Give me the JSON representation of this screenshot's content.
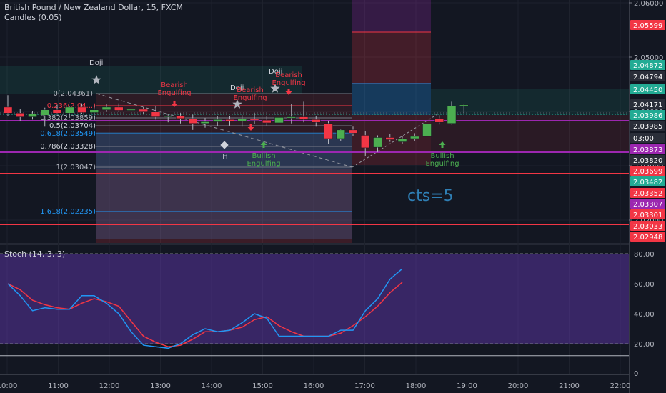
{
  "header": {
    "symbol": "British Pound / New Zealand Dollar, 15, FXCM",
    "indicator": "Candles (0.05)"
  },
  "stoch": {
    "label": "Stoch (14, 3, 3)",
    "k": [
      60,
      52,
      42,
      44,
      43,
      43,
      52,
      52,
      47,
      40,
      28,
      19,
      18,
      17,
      20,
      26,
      30,
      28,
      29,
      34,
      40,
      37,
      25,
      25,
      25,
      25,
      25,
      29,
      29,
      42,
      50,
      63,
      70
    ],
    "d": [
      60,
      56,
      49,
      46,
      44,
      43,
      47,
      50,
      48,
      45,
      35,
      25,
      21,
      18,
      19,
      23,
      28,
      28,
      29,
      31,
      36,
      38,
      32,
      28,
      25,
      25,
      25,
      27,
      32,
      38,
      45,
      54,
      61
    ],
    "k_color": "#2196f3",
    "d_color": "#f23645",
    "ticks": [
      "80.00",
      "60.00",
      "40.00",
      "20.00",
      "0"
    ]
  },
  "price_axis": {
    "ticks": [
      "2.06000",
      "2.05000",
      "2.04000",
      "2.03000",
      "2.02000"
    ],
    "badges": [
      {
        "text": "2.05599",
        "color": "#f23645"
      },
      {
        "text": "2.04872",
        "color": "#22ab94"
      },
      {
        "text": "2.04794",
        "color": "#2a2e39"
      },
      {
        "text": "2.04450",
        "color": "#22ab94"
      },
      {
        "text": "2.04171",
        "color": "#2a2e39"
      },
      {
        "text": "2.03986",
        "color": "#22ab94"
      },
      {
        "text": "2.03985",
        "color": "#2a2e39"
      },
      {
        "text": "03:00",
        "color": "#2a2e39"
      },
      {
        "text": "2.03873",
        "color": "#9c27b0"
      },
      {
        "text": "2.03820",
        "color": "#2a2e39"
      },
      {
        "text": "2.03699",
        "color": "#f23645"
      },
      {
        "text": "2.03482",
        "color": "#22ab94"
      },
      {
        "text": "2.03352",
        "color": "#f23645"
      },
      {
        "text": "2.03307",
        "color": "#9c27b0"
      },
      {
        "text": "2.03301",
        "color": "#f23645"
      },
      {
        "text": "2.03033",
        "color": "#f23645"
      },
      {
        "text": "2.02948",
        "color": "#f23645"
      }
    ]
  },
  "time_axis": {
    "ticks": [
      "10:00",
      "11:00",
      "12:00",
      "13:00",
      "14:00",
      "15:00",
      "16:00",
      "17:00",
      "18:00",
      "19:00",
      "20:00",
      "21:00",
      "22:00"
    ]
  },
  "fib": {
    "levels": [
      {
        "text": "0(2.04361)",
        "color": "#b2b5be"
      },
      {
        "text": "0.236(2.04...)",
        "color": "#f23645"
      },
      {
        "text": "0.382(2.03859)",
        "color": "#b2b5be"
      },
      {
        "text": "0.5(2.03704)",
        "color": "#d1d4dc"
      },
      {
        "text": "0.618(2.03549)",
        "color": "#2196f3"
      },
      {
        "text": "0.786(2.03328)",
        "color": "#d1d4dc"
      },
      {
        "text": "1(2.03047)",
        "color": "#b2b5be"
      },
      {
        "text": "1.618(2.02235)",
        "color": "#2196f3"
      }
    ]
  },
  "annotations": {
    "doji": "Doji",
    "bearish": "Bearish",
    "engulfing": "Engulfing",
    "bullish": "Bullish",
    "h": "H",
    "cts": "cts=5"
  },
  "candles": [
    {
      "o": 2.0408,
      "h": 2.043,
      "l": 2.0392,
      "c": 2.0397
    },
    {
      "o": 2.0397,
      "h": 2.0404,
      "l": 2.0383,
      "c": 2.039
    },
    {
      "o": 2.039,
      "h": 2.04,
      "l": 2.0385,
      "c": 2.0396
    },
    {
      "o": 2.0393,
      "h": 2.0407,
      "l": 2.0372,
      "c": 2.0403
    },
    {
      "o": 2.0403,
      "h": 2.0412,
      "l": 2.0394,
      "c": 2.0397
    },
    {
      "o": 2.0397,
      "h": 2.041,
      "l": 2.0388,
      "c": 2.0408
    },
    {
      "o": 2.0408,
      "h": 2.0415,
      "l": 2.0395,
      "c": 2.0398
    },
    {
      "o": 2.0398,
      "h": 2.0412,
      "l": 2.0385,
      "c": 2.0403
    },
    {
      "o": 2.0403,
      "h": 2.0414,
      "l": 2.0399,
      "c": 2.0408
    },
    {
      "o": 2.0408,
      "h": 2.0415,
      "l": 2.0399,
      "c": 2.0402
    },
    {
      "o": 2.0402,
      "h": 2.0407,
      "l": 2.0398,
      "c": 2.0404
    },
    {
      "o": 2.0404,
      "h": 2.0408,
      "l": 2.0396,
      "c": 2.0399
    },
    {
      "o": 2.0399,
      "h": 2.041,
      "l": 2.0385,
      "c": 2.039
    },
    {
      "o": 2.039,
      "h": 2.0396,
      "l": 2.038,
      "c": 2.0392
    },
    {
      "o": 2.0392,
      "h": 2.0397,
      "l": 2.0378,
      "c": 2.0387
    },
    {
      "o": 2.0387,
      "h": 2.0394,
      "l": 2.0366,
      "c": 2.0378
    },
    {
      "o": 2.0378,
      "h": 2.0388,
      "l": 2.037,
      "c": 2.0381
    },
    {
      "o": 2.0381,
      "h": 2.0391,
      "l": 2.0373,
      "c": 2.0385
    },
    {
      "o": 2.0385,
      "h": 2.0392,
      "l": 2.0374,
      "c": 2.0382
    },
    {
      "o": 2.0382,
      "h": 2.0393,
      "l": 2.0372,
      "c": 2.0386
    },
    {
      "o": 2.0386,
      "h": 2.0397,
      "l": 2.0377,
      "c": 2.0384
    },
    {
      "o": 2.0384,
      "h": 2.0392,
      "l": 2.0374,
      "c": 2.0379
    },
    {
      "o": 2.0379,
      "h": 2.0392,
      "l": 2.0371,
      "c": 2.0389
    },
    {
      "o": 2.0389,
      "h": 2.0414,
      "l": 2.0378,
      "c": 2.039
    },
    {
      "o": 2.039,
      "h": 2.0418,
      "l": 2.038,
      "c": 2.0385
    },
    {
      "o": 2.0385,
      "h": 2.0392,
      "l": 2.0372,
      "c": 2.038
    },
    {
      "o": 2.0378,
      "h": 2.0383,
      "l": 2.034,
      "c": 2.035
    },
    {
      "o": 2.035,
      "h": 2.0368,
      "l": 2.0345,
      "c": 2.0366
    },
    {
      "o": 2.0366,
      "h": 2.0372,
      "l": 2.0354,
      "c": 2.036
    },
    {
      "o": 2.0356,
      "h": 2.0364,
      "l": 2.0318,
      "c": 2.0333
    },
    {
      "o": 2.0334,
      "h": 2.0356,
      "l": 2.0325,
      "c": 2.0352
    },
    {
      "o": 2.0352,
      "h": 2.0358,
      "l": 2.0344,
      "c": 2.0348
    },
    {
      "o": 2.0344,
      "h": 2.0354,
      "l": 2.034,
      "c": 2.035
    },
    {
      "o": 2.035,
      "h": 2.036,
      "l": 2.0346,
      "c": 2.0354
    },
    {
      "o": 2.0354,
      "h": 2.0383,
      "l": 2.0348,
      "c": 2.0377
    },
    {
      "o": 2.0387,
      "h": 2.0393,
      "l": 2.0376,
      "c": 2.038
    },
    {
      "o": 2.0378,
      "h": 2.0418,
      "l": 2.0376,
      "c": 2.041
    },
    {
      "o": 2.041,
      "h": 2.0413,
      "l": 2.0397,
      "c": 2.0412
    }
  ]
}
